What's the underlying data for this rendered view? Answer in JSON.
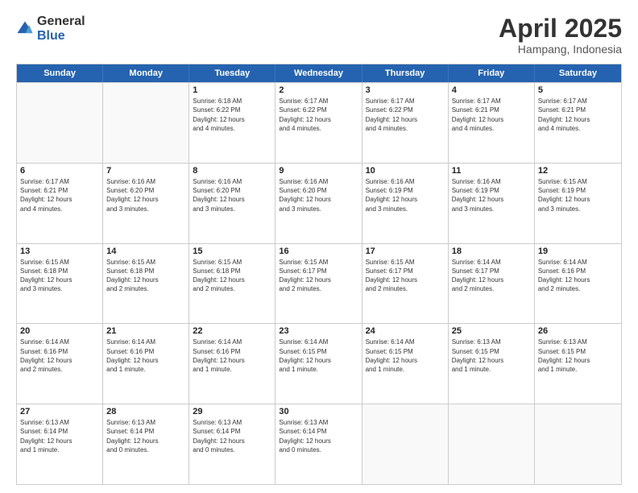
{
  "logo": {
    "general": "General",
    "blue": "Blue"
  },
  "header": {
    "title": "April 2025",
    "subtitle": "Hampang, Indonesia"
  },
  "weekdays": [
    "Sunday",
    "Monday",
    "Tuesday",
    "Wednesday",
    "Thursday",
    "Friday",
    "Saturday"
  ],
  "weeks": [
    [
      {
        "day": "",
        "info": ""
      },
      {
        "day": "",
        "info": ""
      },
      {
        "day": "1",
        "info": "Sunrise: 6:18 AM\nSunset: 6:22 PM\nDaylight: 12 hours\nand 4 minutes."
      },
      {
        "day": "2",
        "info": "Sunrise: 6:17 AM\nSunset: 6:22 PM\nDaylight: 12 hours\nand 4 minutes."
      },
      {
        "day": "3",
        "info": "Sunrise: 6:17 AM\nSunset: 6:22 PM\nDaylight: 12 hours\nand 4 minutes."
      },
      {
        "day": "4",
        "info": "Sunrise: 6:17 AM\nSunset: 6:21 PM\nDaylight: 12 hours\nand 4 minutes."
      },
      {
        "day": "5",
        "info": "Sunrise: 6:17 AM\nSunset: 6:21 PM\nDaylight: 12 hours\nand 4 minutes."
      }
    ],
    [
      {
        "day": "6",
        "info": "Sunrise: 6:17 AM\nSunset: 6:21 PM\nDaylight: 12 hours\nand 4 minutes."
      },
      {
        "day": "7",
        "info": "Sunrise: 6:16 AM\nSunset: 6:20 PM\nDaylight: 12 hours\nand 3 minutes."
      },
      {
        "day": "8",
        "info": "Sunrise: 6:16 AM\nSunset: 6:20 PM\nDaylight: 12 hours\nand 3 minutes."
      },
      {
        "day": "9",
        "info": "Sunrise: 6:16 AM\nSunset: 6:20 PM\nDaylight: 12 hours\nand 3 minutes."
      },
      {
        "day": "10",
        "info": "Sunrise: 6:16 AM\nSunset: 6:19 PM\nDaylight: 12 hours\nand 3 minutes."
      },
      {
        "day": "11",
        "info": "Sunrise: 6:16 AM\nSunset: 6:19 PM\nDaylight: 12 hours\nand 3 minutes."
      },
      {
        "day": "12",
        "info": "Sunrise: 6:15 AM\nSunset: 6:19 PM\nDaylight: 12 hours\nand 3 minutes."
      }
    ],
    [
      {
        "day": "13",
        "info": "Sunrise: 6:15 AM\nSunset: 6:18 PM\nDaylight: 12 hours\nand 3 minutes."
      },
      {
        "day": "14",
        "info": "Sunrise: 6:15 AM\nSunset: 6:18 PM\nDaylight: 12 hours\nand 2 minutes."
      },
      {
        "day": "15",
        "info": "Sunrise: 6:15 AM\nSunset: 6:18 PM\nDaylight: 12 hours\nand 2 minutes."
      },
      {
        "day": "16",
        "info": "Sunrise: 6:15 AM\nSunset: 6:17 PM\nDaylight: 12 hours\nand 2 minutes."
      },
      {
        "day": "17",
        "info": "Sunrise: 6:15 AM\nSunset: 6:17 PM\nDaylight: 12 hours\nand 2 minutes."
      },
      {
        "day": "18",
        "info": "Sunrise: 6:14 AM\nSunset: 6:17 PM\nDaylight: 12 hours\nand 2 minutes."
      },
      {
        "day": "19",
        "info": "Sunrise: 6:14 AM\nSunset: 6:16 PM\nDaylight: 12 hours\nand 2 minutes."
      }
    ],
    [
      {
        "day": "20",
        "info": "Sunrise: 6:14 AM\nSunset: 6:16 PM\nDaylight: 12 hours\nand 2 minutes."
      },
      {
        "day": "21",
        "info": "Sunrise: 6:14 AM\nSunset: 6:16 PM\nDaylight: 12 hours\nand 1 minute."
      },
      {
        "day": "22",
        "info": "Sunrise: 6:14 AM\nSunset: 6:16 PM\nDaylight: 12 hours\nand 1 minute."
      },
      {
        "day": "23",
        "info": "Sunrise: 6:14 AM\nSunset: 6:15 PM\nDaylight: 12 hours\nand 1 minute."
      },
      {
        "day": "24",
        "info": "Sunrise: 6:14 AM\nSunset: 6:15 PM\nDaylight: 12 hours\nand 1 minute."
      },
      {
        "day": "25",
        "info": "Sunrise: 6:13 AM\nSunset: 6:15 PM\nDaylight: 12 hours\nand 1 minute."
      },
      {
        "day": "26",
        "info": "Sunrise: 6:13 AM\nSunset: 6:15 PM\nDaylight: 12 hours\nand 1 minute."
      }
    ],
    [
      {
        "day": "27",
        "info": "Sunrise: 6:13 AM\nSunset: 6:14 PM\nDaylight: 12 hours\nand 1 minute."
      },
      {
        "day": "28",
        "info": "Sunrise: 6:13 AM\nSunset: 6:14 PM\nDaylight: 12 hours\nand 0 minutes."
      },
      {
        "day": "29",
        "info": "Sunrise: 6:13 AM\nSunset: 6:14 PM\nDaylight: 12 hours\nand 0 minutes."
      },
      {
        "day": "30",
        "info": "Sunrise: 6:13 AM\nSunset: 6:14 PM\nDaylight: 12 hours\nand 0 minutes."
      },
      {
        "day": "",
        "info": ""
      },
      {
        "day": "",
        "info": ""
      },
      {
        "day": "",
        "info": ""
      }
    ]
  ]
}
